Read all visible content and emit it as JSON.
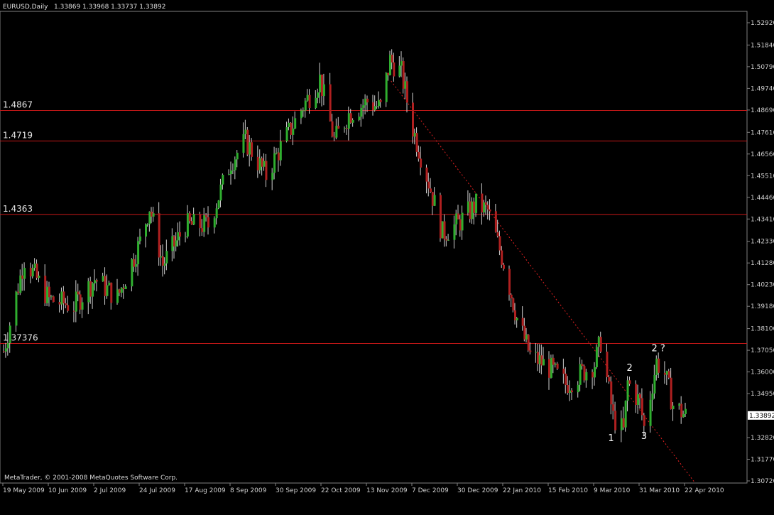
{
  "header": {
    "symbol": "EURUSD,Daily",
    "ohlc": "1.33869 1.33968 1.33737 1.33892"
  },
  "footer": {
    "copyright": "MetaTrader, © 2001-2008 MetaQuotes Software Corp."
  },
  "colors": {
    "background": "#000000",
    "bull_candle": "#2fae2f",
    "bear_candle": "#b02020",
    "wick": "#cfcfcf",
    "level_line": "#c81818",
    "trendline": "#e02020",
    "axis": "#808080"
  },
  "chart_data": {
    "type": "candlestick",
    "title": "EURUSD,Daily",
    "ylim": [
      1.3072,
      1.5292
    ],
    "y_ticks": [
      "1.52920",
      "1.51840",
      "1.50790",
      "1.49740",
      "1.48690",
      "1.47610",
      "1.46560",
      "1.45510",
      "1.44460",
      "1.43410",
      "1.42330",
      "1.41280",
      "1.40230",
      "1.39180",
      "1.38100",
      "1.37050",
      "1.36000",
      "1.34950",
      "1.33892",
      "1.32820",
      "1.31770",
      "1.30720"
    ],
    "current_price": "1.33892",
    "x_ticks": [
      "19 May 2009",
      "10 Jun 2009",
      "2 Jul 2009",
      "24 Jul 2009",
      "17 Aug 2009",
      "8 Sep 2009",
      "30 Sep 2009",
      "22 Oct 2009",
      "13 Nov 2009",
      "7 Dec 2009",
      "30 Dec 2009",
      "22 Jan 2010",
      "15 Feb 2010",
      "9 Mar 2010",
      "31 Mar 2010",
      "22 Apr 2010"
    ],
    "horizontal_levels": [
      {
        "value": 1.4867,
        "label": "1.4867"
      },
      {
        "value": 1.4719,
        "label": "1.4719"
      },
      {
        "value": 1.4363,
        "label": "1.4363"
      },
      {
        "value": 1.3738,
        "label": "1.37376"
      }
    ],
    "trendline": {
      "start": {
        "date": "26 Nov 2009",
        "price": 1.501
      },
      "end": {
        "date": "27 Apr 2010",
        "price": 1.3065
      }
    },
    "annotations": [
      {
        "text": "1",
        "date": "16 Mar 2010",
        "price": 1.3265
      },
      {
        "text": "2",
        "date": "25 Mar 2010",
        "price": 1.3605
      },
      {
        "text": "3",
        "date": "1 Apr 2010",
        "price": 1.3275
      },
      {
        "text": "2 ?",
        "date": "6 Apr 2010",
        "price": 1.37
      }
    ],
    "price_path": [
      {
        "date": "19 May 2009",
        "close": 1.37
      },
      {
        "date": "29 May 2009",
        "close": 1.415
      },
      {
        "date": "10 Jun 2009",
        "close": 1.395
      },
      {
        "date": "22 Jun 2009",
        "close": 1.392
      },
      {
        "date": "2 Jul 2009",
        "close": 1.405
      },
      {
        "date": "13 Jul 2009",
        "close": 1.396
      },
      {
        "date": "24 Jul 2009",
        "close": 1.423
      },
      {
        "date": "29 Jul 2009",
        "close": 1.44
      },
      {
        "date": "5 Aug 2009",
        "close": 1.412
      },
      {
        "date": "17 Aug 2009",
        "close": 1.431
      },
      {
        "date": "28 Aug 2009",
        "close": 1.431
      },
      {
        "date": "8 Sep 2009",
        "close": 1.462
      },
      {
        "date": "15 Sep 2009",
        "close": 1.472
      },
      {
        "date": "25 Sep 2009",
        "close": 1.455
      },
      {
        "date": "30 Sep 2009",
        "close": 1.465
      },
      {
        "date": "13 Oct 2009",
        "close": 1.489
      },
      {
        "date": "21 Oct 2009",
        "close": 1.502
      },
      {
        "date": "28 Oct 2009",
        "close": 1.472
      },
      {
        "date": "4 Nov 2009",
        "close": 1.485
      },
      {
        "date": "13 Nov 2009",
        "close": 1.491
      },
      {
        "date": "20 Nov 2009",
        "close": 1.488
      },
      {
        "date": "25 Nov 2009",
        "close": 1.511
      },
      {
        "date": "1 Dec 2009",
        "close": 1.505
      },
      {
        "date": "7 Dec 2009",
        "close": 1.478
      },
      {
        "date": "15 Dec 2009",
        "close": 1.452
      },
      {
        "date": "22 Dec 2009",
        "close": 1.427
      },
      {
        "date": "30 Dec 2009",
        "close": 1.432
      },
      {
        "date": "8 Jan 2010",
        "close": 1.441
      },
      {
        "date": "14 Jan 2010",
        "close": 1.438
      },
      {
        "date": "22 Jan 2010",
        "close": 1.413
      },
      {
        "date": "29 Jan 2010",
        "close": 1.386
      },
      {
        "date": "5 Feb 2010",
        "close": 1.368
      },
      {
        "date": "15 Feb 2010",
        "close": 1.362
      },
      {
        "date": "23 Feb 2010",
        "close": 1.354
      },
      {
        "date": "9 Mar 2010",
        "close": 1.364
      },
      {
        "date": "12 Mar 2010",
        "close": 1.375
      },
      {
        "date": "18 Mar 2010",
        "close": 1.338
      },
      {
        "date": "23 Mar 2010",
        "close": 1.331
      },
      {
        "date": "25 Mar 2010",
        "close": 1.355
      },
      {
        "date": "31 Mar 2010",
        "close": 1.345
      },
      {
        "date": "2 Apr 2010",
        "close": 1.333
      },
      {
        "date": "8 Apr 2010",
        "close": 1.365
      },
      {
        "date": "12 Apr 2010",
        "close": 1.359
      },
      {
        "date": "16 Apr 2010",
        "close": 1.344
      },
      {
        "date": "22 Apr 2010",
        "close": 1.3389
      }
    ]
  }
}
